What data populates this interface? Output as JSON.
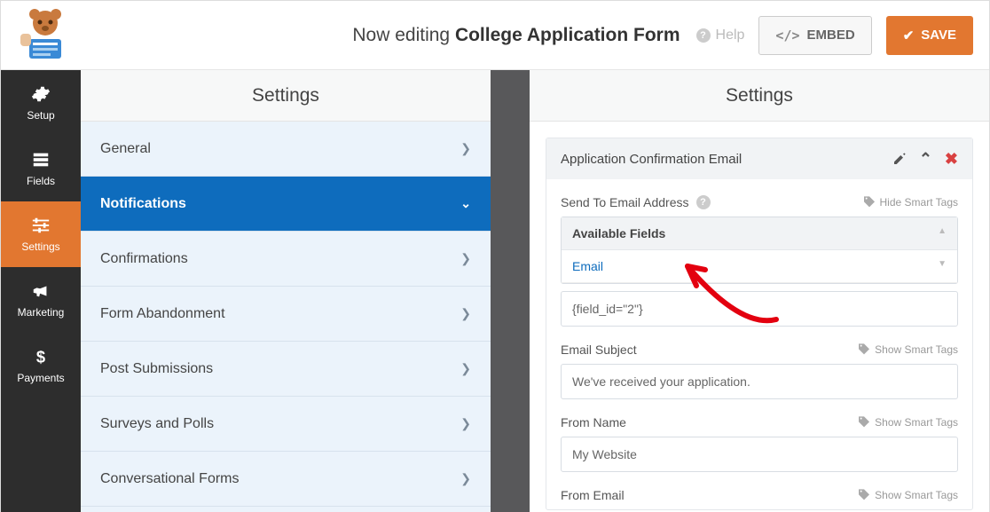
{
  "header": {
    "editing_prefix": "Now editing",
    "form_name": "College Application Form",
    "help": "Help",
    "embed": "EMBED",
    "save": "SAVE"
  },
  "rail": {
    "setup": "Setup",
    "fields": "Fields",
    "settings": "Settings",
    "marketing": "Marketing",
    "payments": "Payments"
  },
  "panel": {
    "title": "Settings",
    "items": {
      "general": "General",
      "notifications": "Notifications",
      "confirmations": "Confirmations",
      "form_abandonment": "Form Abandonment",
      "post_submissions": "Post Submissions",
      "surveys_polls": "Surveys and Polls",
      "conversational": "Conversational Forms"
    }
  },
  "content": {
    "title": "Settings",
    "card_title": "Application Confirmation Email",
    "send_to_label": "Send To Email Address",
    "hide_smart": "Hide Smart Tags",
    "available_fields": "Available Fields",
    "email_option": "Email",
    "send_to_value": "{field_id=\"2\"}",
    "subject_label": "Email Subject",
    "show_smart": "Show Smart Tags",
    "subject_value": "We've received your application.",
    "from_name_label": "From Name",
    "from_name_value": "My Website",
    "from_email_label": "From Email"
  }
}
